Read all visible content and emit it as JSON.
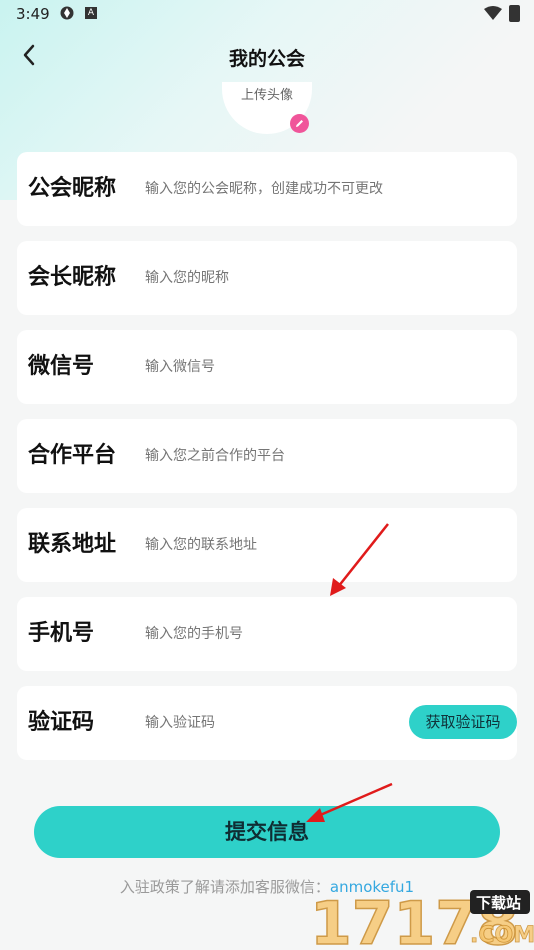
{
  "status_bar": {
    "time": "3:49",
    "icon_a": "aperture-icon",
    "icon_b_text": "A"
  },
  "header": {
    "title": "我的公会",
    "back_icon": "chevron-left-icon"
  },
  "avatar": {
    "upload_label": "上传头像",
    "edit_icon": "pencil-icon"
  },
  "form": {
    "fields": [
      {
        "label": "公会昵称",
        "placeholder": "输入您的公会昵称，创建成功不可更改"
      },
      {
        "label": "会长昵称",
        "placeholder": "输入您的昵称"
      },
      {
        "label": "微信号",
        "placeholder": "输入微信号"
      },
      {
        "label": "合作平台",
        "placeholder": "输入您之前合作的平台"
      },
      {
        "label": "联系地址",
        "placeholder": "输入您的联系地址"
      },
      {
        "label": "手机号",
        "placeholder": "输入您的手机号"
      },
      {
        "label": "验证码",
        "placeholder": "输入验证码"
      }
    ],
    "get_code_label": "获取验证码"
  },
  "submit_label": "提交信息",
  "footer": {
    "note": "入驻政策了解请添加客服微信：",
    "wechat_id": "anmokefu1"
  },
  "watermark": {
    "text": "17178",
    "badge": "下载站",
    "suffix": ".COM"
  },
  "colors": {
    "accent": "#2ed1c9",
    "badge": "#f0559a",
    "link": "#34a8e0",
    "arrow": "#e01b1b"
  }
}
